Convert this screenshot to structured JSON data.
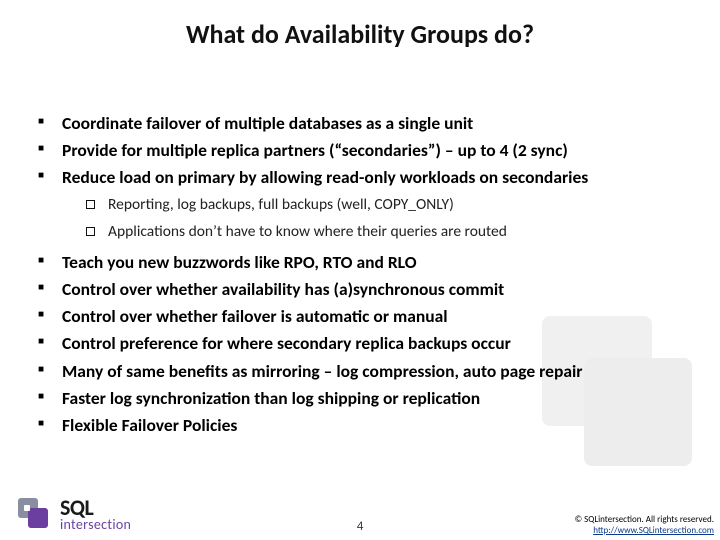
{
  "slide": {
    "title": "What do Availability Groups do?",
    "bullets_top": [
      "Coordinate failover of multiple databases as a single unit",
      "Provide for multiple replica partners (“secondaries”) – up to 4 (2 sync)",
      "Reduce load on primary by allowing read-only workloads on secondaries"
    ],
    "sub_bullets": [
      "Reporting, log backups, full backups (well, COPY_ONLY)",
      "Applications don’t have to know where their queries are routed"
    ],
    "bullets_bottom": [
      "Teach you new buzzwords like RPO, RTO and RLO",
      "Control over whether availability has (a)synchronous commit",
      "Control over whether failover is automatic or manual",
      "Control preference for where secondary replica backups occur",
      "Many of same benefits as mirroring – log compression, auto page repair",
      "Faster log synchronization than log shipping or replication",
      "Flexible Failover Policies"
    ]
  },
  "footer": {
    "logo_line1": "SQL",
    "logo_line2": "intersection",
    "page_number": "4",
    "copyright_line1": "© SQLintersection. All rights reserved.",
    "copyright_line2": "http://www.SQLintersection.com"
  }
}
